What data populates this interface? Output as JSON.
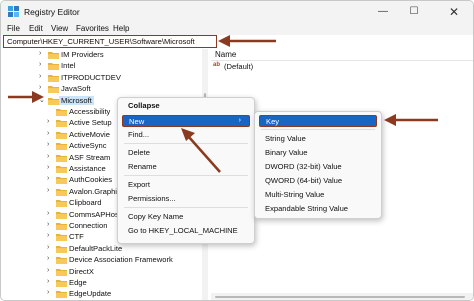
{
  "window": {
    "title": "Registry Editor",
    "controls": {
      "minimize": "—",
      "maximize": "☐",
      "close": "✕"
    }
  },
  "menu": [
    "File",
    "Edit",
    "View",
    "Favorites",
    "Help"
  ],
  "address": "Computer\\HKEY_CURRENT_USER\\Software\\Microsoft",
  "tree": {
    "rows": [
      {
        "label": "IM Providers",
        "indent": 0,
        "chevron": "›"
      },
      {
        "label": "Intel",
        "indent": 0,
        "chevron": "›"
      },
      {
        "label": "ITPRODUCTDEV",
        "indent": 0,
        "chevron": "›"
      },
      {
        "label": "JavaSoft",
        "indent": 0,
        "chevron": "›"
      },
      {
        "label": "Microsoft",
        "indent": 0,
        "chevron": "⌄",
        "selected": true
      },
      {
        "label": "Accessibility",
        "indent": 1,
        "chevron": ""
      },
      {
        "label": "Active Setup",
        "indent": 1,
        "chevron": "›"
      },
      {
        "label": "ActiveMovie",
        "indent": 1,
        "chevron": "›"
      },
      {
        "label": "ActiveSync",
        "indent": 1,
        "chevron": "›"
      },
      {
        "label": "ASF Stream",
        "indent": 1,
        "chevron": "›"
      },
      {
        "label": "Assistance",
        "indent": 1,
        "chevron": "›"
      },
      {
        "label": "AuthCookies",
        "indent": 1,
        "chevron": "›"
      },
      {
        "label": "Avalon.Graphics",
        "indent": 1,
        "chevron": "›"
      },
      {
        "label": "Clipboard",
        "indent": 1,
        "chevron": ""
      },
      {
        "label": "CommsAPHost",
        "indent": 1,
        "chevron": "›"
      },
      {
        "label": "Connection",
        "indent": 1,
        "chevron": "›"
      },
      {
        "label": "CTF",
        "indent": 1,
        "chevron": "›"
      },
      {
        "label": "DefaultPackLite",
        "indent": 1,
        "chevron": "›"
      },
      {
        "label": "Device Association Framework",
        "indent": 1,
        "chevron": "›"
      },
      {
        "label": "DirectX",
        "indent": 1,
        "chevron": "›"
      },
      {
        "label": "Edge",
        "indent": 1,
        "chevron": "›"
      },
      {
        "label": "EdgeUpdate",
        "indent": 1,
        "chevron": "›"
      }
    ]
  },
  "values": {
    "header": "Name",
    "rows": [
      {
        "icon": "ab",
        "name": "(Default)"
      }
    ]
  },
  "context_menu": {
    "items": [
      {
        "label": "Collapse",
        "bold": true
      },
      {
        "label": "New",
        "highlighted": true,
        "submenu": "›"
      },
      {
        "label": "Find..."
      },
      {
        "sep": true
      },
      {
        "label": "Delete"
      },
      {
        "label": "Rename"
      },
      {
        "sep": true
      },
      {
        "label": "Export"
      },
      {
        "label": "Permissions..."
      },
      {
        "sep": true
      },
      {
        "label": "Copy Key Name"
      },
      {
        "label": "Go to HKEY_LOCAL_MACHINE"
      }
    ]
  },
  "submenu": {
    "items": [
      {
        "label": "Key",
        "highlighted": true
      },
      {
        "sep": true
      },
      {
        "label": "String Value"
      },
      {
        "label": "Binary Value"
      },
      {
        "label": "DWORD (32-bit) Value"
      },
      {
        "label": "QWORD (64-bit) Value"
      },
      {
        "label": "Multi-String Value"
      },
      {
        "label": "Expandable String Value"
      }
    ]
  },
  "colors": {
    "annotation_arrow": "#8b3a1f",
    "highlight": "#1a64c4",
    "folder": "#e8b33a",
    "selected_row": "#cce4f7"
  }
}
